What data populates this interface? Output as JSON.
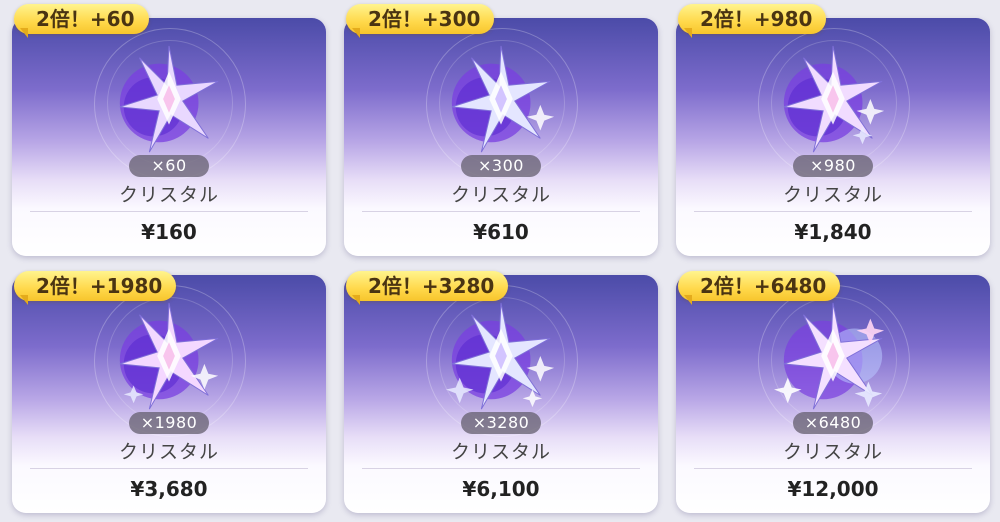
{
  "colors": {
    "card_top": "#4b4ba8",
    "card_mid": "#b8a6e6",
    "card_bottom": "#ffffff",
    "tag_yellow": "#ffd84a",
    "tag_text": "#4a3412",
    "pill_bg": "#5f5a69"
  },
  "items": [
    {
      "bonus": "2倍！+60",
      "qty": "×60",
      "name": "クリスタル",
      "price": "¥160",
      "icon": "crystal-icon"
    },
    {
      "bonus": "2倍！+300",
      "qty": "×300",
      "name": "クリスタル",
      "price": "¥610",
      "icon": "crystal-icon"
    },
    {
      "bonus": "2倍！+980",
      "qty": "×980",
      "name": "クリスタル",
      "price": "¥1,840",
      "icon": "crystal-icon"
    },
    {
      "bonus": "2倍！+1980",
      "qty": "×1980",
      "name": "クリスタル",
      "price": "¥3,680",
      "icon": "crystal-icon"
    },
    {
      "bonus": "2倍！+3280",
      "qty": "×3280",
      "name": "クリスタル",
      "price": "¥6,100",
      "icon": "crystal-icon"
    },
    {
      "bonus": "2倍！+6480",
      "qty": "×6480",
      "name": "クリスタル",
      "price": "¥12,000",
      "icon": "crystal-icon"
    }
  ]
}
